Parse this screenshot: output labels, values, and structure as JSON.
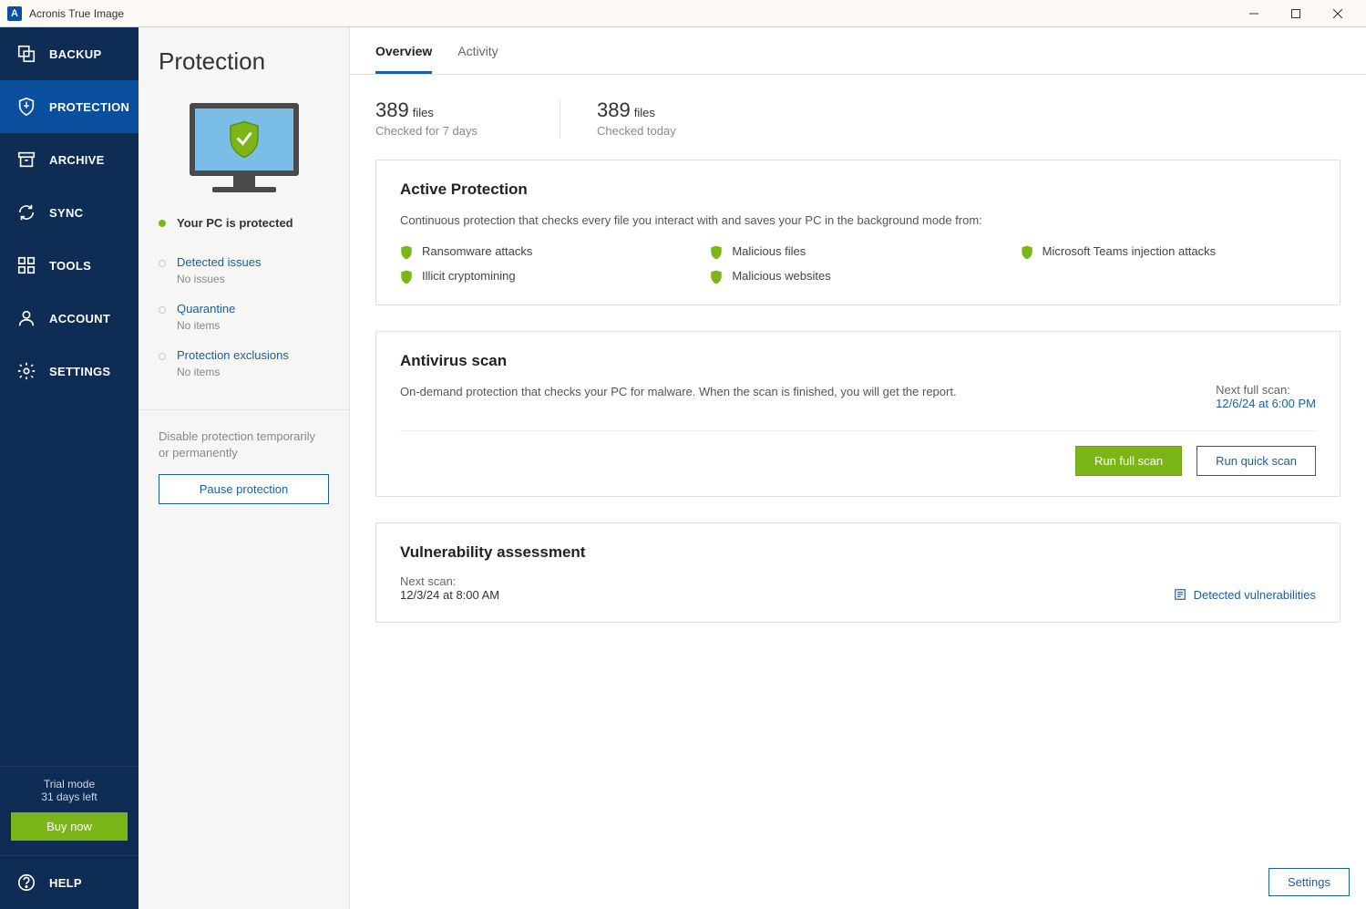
{
  "window": {
    "title": "Acronis True Image"
  },
  "nav": {
    "items": [
      {
        "label": "BACKUP"
      },
      {
        "label": "PROTECTION"
      },
      {
        "label": "ARCHIVE"
      },
      {
        "label": "SYNC"
      },
      {
        "label": "TOOLS"
      },
      {
        "label": "ACCOUNT"
      },
      {
        "label": "SETTINGS"
      }
    ],
    "trial1": "Trial mode",
    "trial2": "31 days left",
    "buy": "Buy now",
    "help": "HELP"
  },
  "mid": {
    "title": "Protection",
    "status": "Your PC is protected",
    "sections": {
      "issues": {
        "label": "Detected issues",
        "sub": "No issues"
      },
      "quarantine": {
        "label": "Quarantine",
        "sub": "No items"
      },
      "exclusions": {
        "label": "Protection exclusions",
        "sub": "No items"
      }
    },
    "disable_text": "Disable protection temporarily or permanently",
    "pause": "Pause protection"
  },
  "main": {
    "tabs": {
      "overview": "Overview",
      "activity": "Activity"
    },
    "stats": {
      "checked7": {
        "num": "389",
        "unit": "files",
        "sub": "Checked for 7 days"
      },
      "today": {
        "num": "389",
        "unit": "files",
        "sub": "Checked today"
      }
    },
    "active": {
      "title": "Active Protection",
      "desc": "Continuous protection that checks every file you interact with and saves your PC in the background mode from:",
      "threats": [
        "Ransomware attacks",
        "Malicious files",
        "Microsoft Teams injection attacks",
        "Illicit cryptomining",
        "Malicious websites"
      ]
    },
    "antivirus": {
      "title": "Antivirus scan",
      "desc": "On-demand protection that checks your PC for malware. When the scan is finished, you will get the report.",
      "next_label": "Next full scan:",
      "next_value": "12/6/24 at 6:00 PM",
      "full": "Run full scan",
      "quick": "Run quick scan"
    },
    "vuln": {
      "title": "Vulnerability assessment",
      "next_label": "Next scan:",
      "next_value": "12/3/24 at 8:00 AM",
      "link": "Detected vulnerabilities"
    },
    "settings": "Settings"
  }
}
